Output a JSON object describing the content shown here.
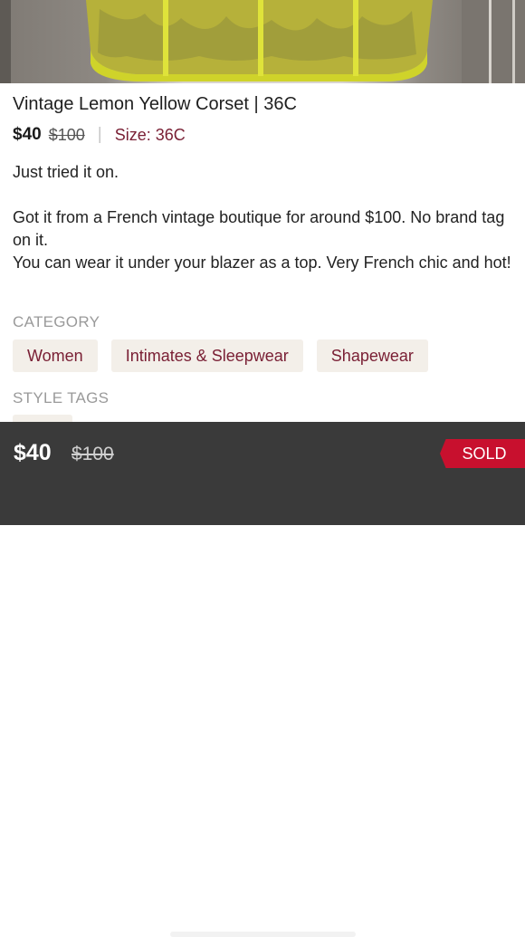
{
  "listing": {
    "title": "Vintage Lemon Yellow Corset | 36C",
    "price": "$40",
    "original_price": "$100",
    "separator": "|",
    "size": "Size: 36C",
    "description": [
      "Just tried it on.",
      "Got it from a French vintage boutique for around $100. No brand tag on it.",
      "You can wear it under your blazer as a top. Very French chic and hot!"
    ]
  },
  "category": {
    "label": "CATEGORY",
    "tags": [
      "Women",
      "Intimates & Sleepwear",
      "Shapewear"
    ]
  },
  "style_tags": {
    "label": "STYLE TAGS"
  },
  "bottom_bar": {
    "price": "$40",
    "original_price": "$100",
    "status": "SOLD"
  },
  "colors": {
    "accent": "#7a2035",
    "chip_bg": "#f3efe9",
    "sold_badge": "#c8102e",
    "bottom_bar_bg": "#3a3a3a"
  }
}
